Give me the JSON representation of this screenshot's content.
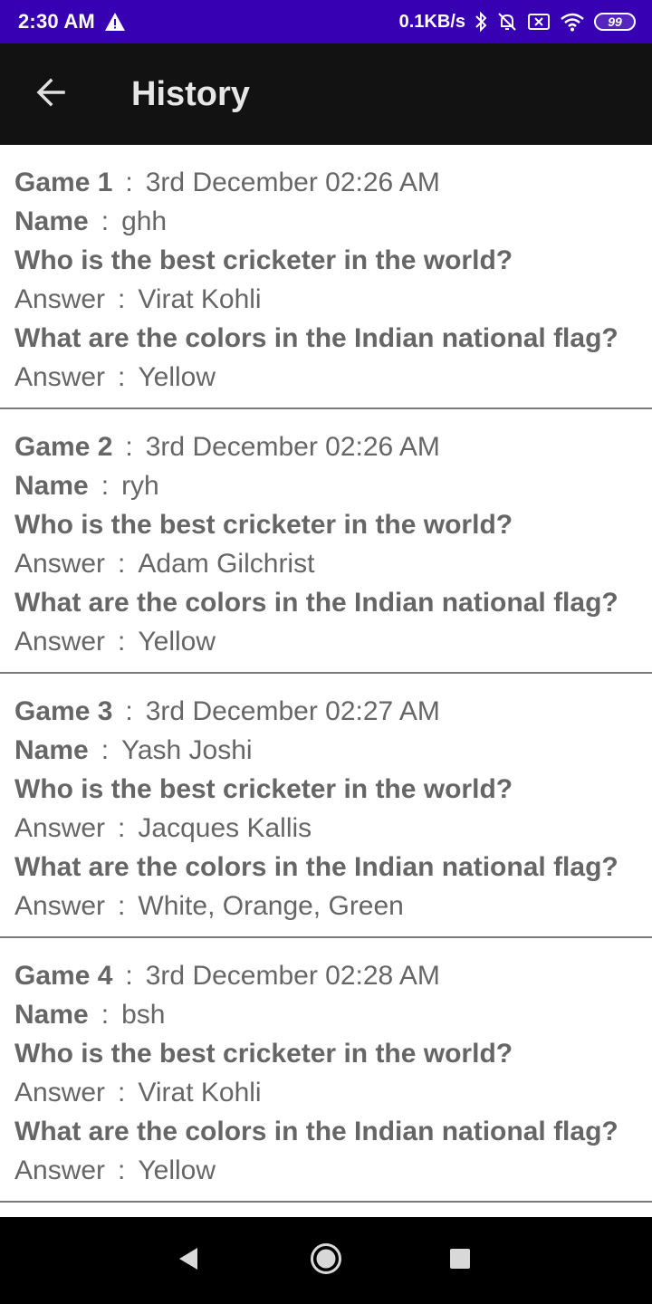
{
  "status_bar": {
    "time": "2:30 AM",
    "net_speed": "0.1KB/s",
    "battery": "99",
    "icons": [
      "warning-icon",
      "bluetooth-icon",
      "silent-bell-icon",
      "sim-off-icon",
      "wifi-icon",
      "battery-icon"
    ]
  },
  "app_bar": {
    "title": "History",
    "back_icon": "arrow-left-icon"
  },
  "labels": {
    "game": "Game",
    "name": "Name",
    "answer": "Answer",
    "separator": ":"
  },
  "games": [
    {
      "game_label": "Game 1",
      "date": "3rd December 02:26 AM",
      "name": "ghh",
      "q1": "Who is the best cricketer in the world?",
      "a1": "Virat Kohli",
      "q2": "What are the colors in the Indian national flag?",
      "a2": "Yellow"
    },
    {
      "game_label": "Game 2",
      "date": "3rd December 02:26 AM",
      "name": "ryh",
      "q1": "Who is the best cricketer in the world?",
      "a1": "Adam Gilchrist",
      "q2": "What are the colors in the Indian national flag?",
      "a2": "Yellow"
    },
    {
      "game_label": "Game 3",
      "date": "3rd December 02:27 AM",
      "name": "Yash Joshi",
      "q1": "Who is the best cricketer in the world?",
      "a1": "Jacques Kallis",
      "q2": "What are the colors in the Indian national flag?",
      "a2": "White, Orange, Green"
    },
    {
      "game_label": "Game 4",
      "date": "3rd December 02:28 AM",
      "name": "bsh",
      "q1": "Who is the best cricketer in the world?",
      "a1": "Virat Kohli",
      "q2": "What are the colors in the Indian national flag?",
      "a2": "Yellow"
    }
  ],
  "nav_bar": {
    "icons": [
      "back-triangle-icon",
      "home-circle-icon",
      "recents-square-icon"
    ]
  },
  "colors": {
    "status_bar": "#3700b3",
    "app_bar": "#121212",
    "text": "#666666",
    "divider": "#7a7a7a"
  }
}
